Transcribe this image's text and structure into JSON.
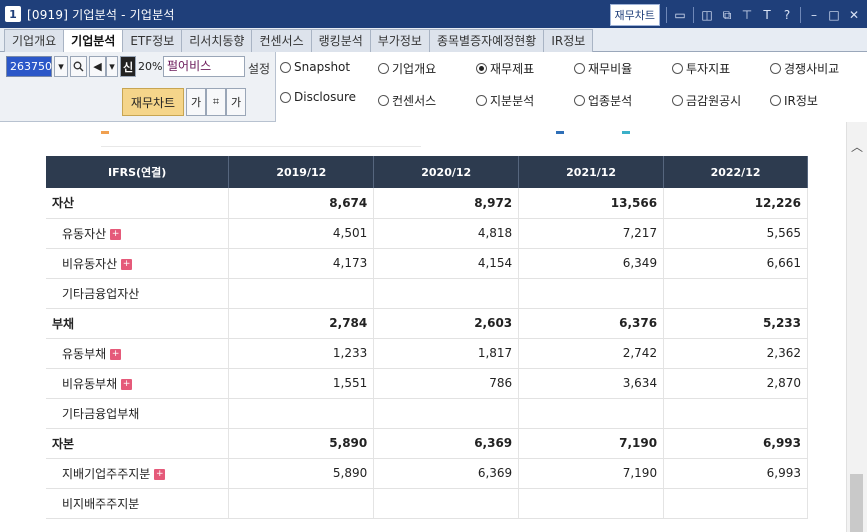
{
  "window": {
    "number": "1",
    "title": "[0919] 기업분석 - 기업분석",
    "button_label": "재무차트",
    "icons": [
      "chart-icon",
      "restore-icon",
      "copy-icon",
      "pin-icon",
      "font-icon",
      "help-icon",
      "minimize-icon",
      "maximize-icon",
      "close-icon"
    ]
  },
  "tabs": [
    "기업개요",
    "기업분석",
    "ETF정보",
    "리서치동향",
    "컨센서스",
    "랭킹분석",
    "부가정보",
    "종목별증자예정현황",
    "IR정보"
  ],
  "active_tab": "기업분석",
  "controls": {
    "code": "263750",
    "new_badge": "신",
    "percent": "20%",
    "company": "펄어비스",
    "setting": "설정",
    "chart_button": "재무차트",
    "font_small": "가",
    "font_large": "가"
  },
  "radios": [
    {
      "label": "Snapshot",
      "selected": false
    },
    {
      "label": "기업개요",
      "selected": false
    },
    {
      "label": "재무제표",
      "selected": true
    },
    {
      "label": "재무비율",
      "selected": false
    },
    {
      "label": "투자지표",
      "selected": false
    },
    {
      "label": "경쟁사비교",
      "selected": false
    },
    {
      "label": "Disclosure",
      "selected": false
    },
    {
      "label": "컨센서스",
      "selected": false
    },
    {
      "label": "지분분석",
      "selected": false
    },
    {
      "label": "업종분석",
      "selected": false
    },
    {
      "label": "금감원공시",
      "selected": false
    },
    {
      "label": "IR정보",
      "selected": false
    }
  ],
  "table": {
    "header": "IFRS(연결)",
    "columns": [
      "2019/12",
      "2020/12",
      "2021/12",
      "2022/12"
    ],
    "rows": [
      {
        "label": "자산",
        "type": "major",
        "plus": false,
        "values": [
          "8,674",
          "8,972",
          "13,566",
          "12,226"
        ]
      },
      {
        "label": "유동자산",
        "type": "sub",
        "plus": true,
        "values": [
          "4,501",
          "4,818",
          "7,217",
          "5,565"
        ]
      },
      {
        "label": "비유동자산",
        "type": "sub",
        "plus": true,
        "values": [
          "4,173",
          "4,154",
          "6,349",
          "6,661"
        ]
      },
      {
        "label": "기타금융업자산",
        "type": "sub",
        "plus": false,
        "values": [
          "",
          "",
          "",
          ""
        ]
      },
      {
        "label": "부채",
        "type": "major",
        "plus": false,
        "values": [
          "2,784",
          "2,603",
          "6,376",
          "5,233"
        ]
      },
      {
        "label": "유동부채",
        "type": "sub",
        "plus": true,
        "values": [
          "1,233",
          "1,817",
          "2,742",
          "2,362"
        ]
      },
      {
        "label": "비유동부채",
        "type": "sub",
        "plus": true,
        "values": [
          "1,551",
          "786",
          "3,634",
          "2,870"
        ]
      },
      {
        "label": "기타금융업부채",
        "type": "sub",
        "plus": false,
        "values": [
          "",
          "",
          "",
          ""
        ]
      },
      {
        "label": "자본",
        "type": "major",
        "plus": false,
        "values": [
          "5,890",
          "6,369",
          "7,190",
          "6,993"
        ]
      },
      {
        "label": "지배기업주주지분",
        "type": "sub",
        "plus": true,
        "values": [
          "5,890",
          "6,369",
          "7,190",
          "6,993"
        ]
      },
      {
        "label": "비지배주주지분",
        "type": "sub",
        "plus": false,
        "values": [
          "",
          "",
          "",
          ""
        ]
      }
    ]
  },
  "colors": {
    "titlebar": "#1f3f7a",
    "table_header": "#2d3b4f",
    "plus_icon": "#e55a7a",
    "legend_orange": "#f0a050",
    "legend_blue": "#2e6fb7",
    "legend_cyan": "#3bb0c8"
  }
}
